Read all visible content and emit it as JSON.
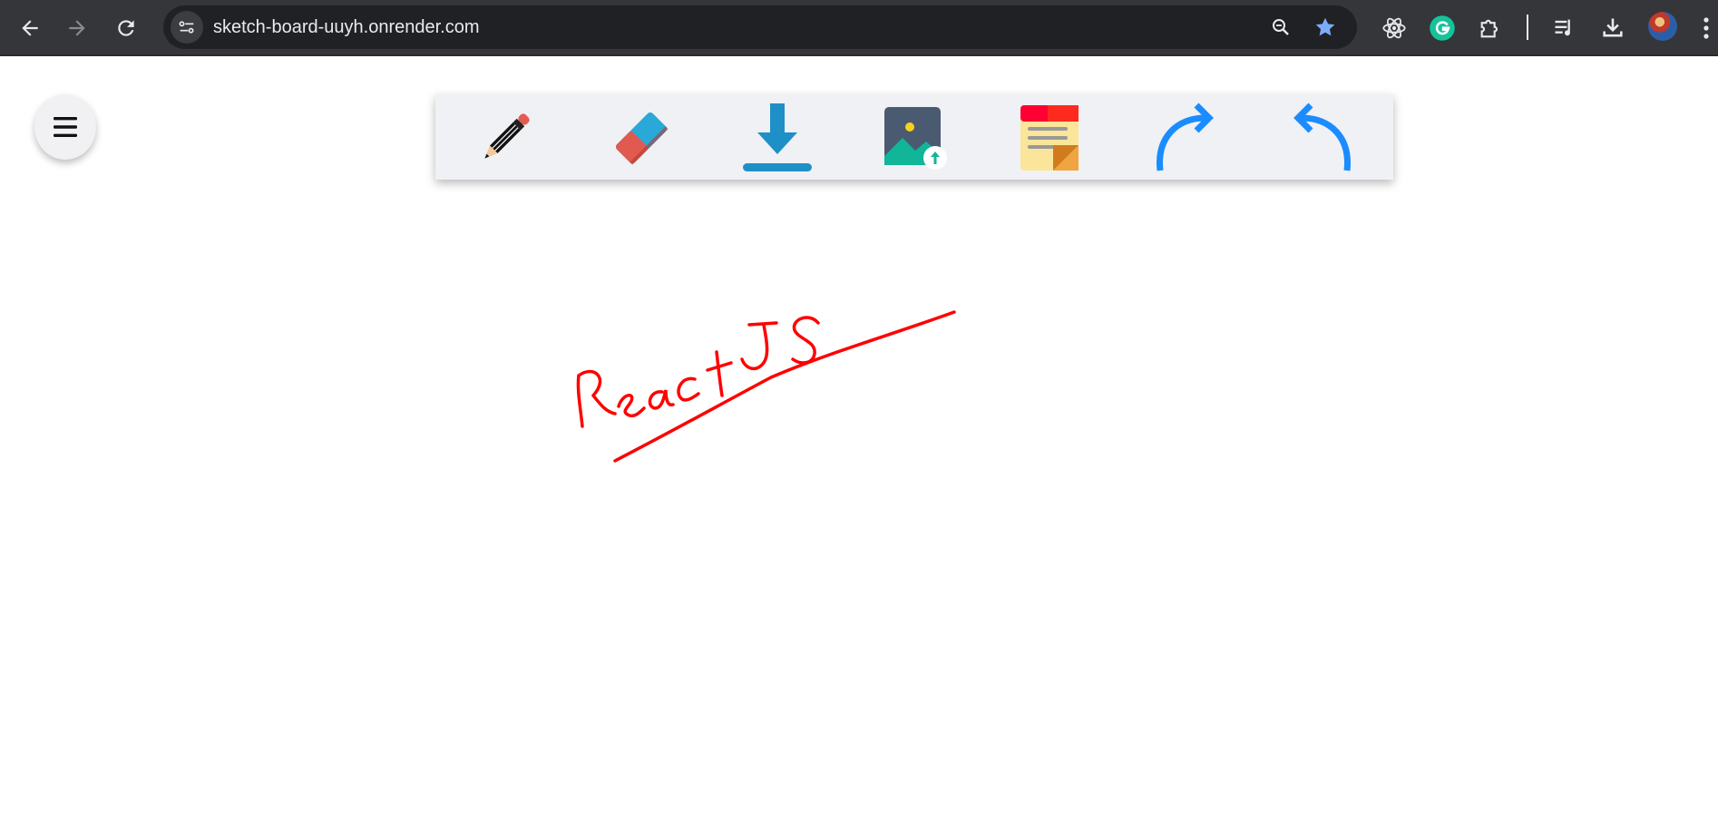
{
  "browser": {
    "url": "sketch-board-uuyh.onrender.com",
    "nav_icons": [
      "back-arrow-icon",
      "forward-arrow-icon",
      "reload-icon"
    ],
    "omnibox_icons": [
      "site-settings-icon",
      "zoom-icon",
      "bookmark-star-icon"
    ],
    "extension_icons": [
      "react-devtools-icon",
      "grammarly-icon",
      "extensions-puzzle-icon",
      "media-playlist-icon",
      "download-icon",
      "profile-avatar",
      "more-menu-icon"
    ]
  },
  "app": {
    "menu_icon": "hamburger-menu-icon",
    "toolbar": {
      "tools": [
        {
          "name": "pencil",
          "icon": "pencil-icon"
        },
        {
          "name": "eraser",
          "icon": "eraser-icon"
        },
        {
          "name": "download",
          "icon": "download-icon"
        },
        {
          "name": "upload-image",
          "icon": "image-upload-icon"
        },
        {
          "name": "sticky-note",
          "icon": "sticky-note-icon"
        },
        {
          "name": "redo",
          "icon": "redo-icon"
        },
        {
          "name": "undo",
          "icon": "undo-icon"
        }
      ]
    },
    "canvas": {
      "stroke_color": "#ff0000",
      "content": "handwritten red strokes reading 'ReactJS' with an underline stroke"
    }
  },
  "colors": {
    "browser_bar": "#35363a",
    "omnibox": "#202124",
    "toolbar_bg": "#f0f1f4",
    "accent_blue": "#1a8cff",
    "stroke_red": "#ff0000"
  }
}
